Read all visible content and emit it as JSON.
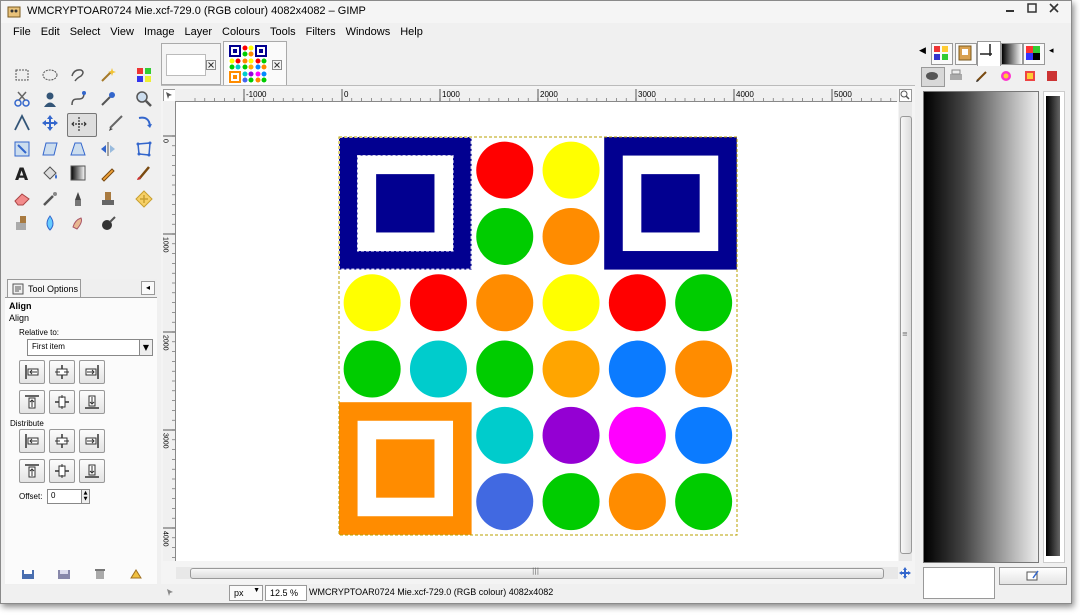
{
  "window": {
    "title": "WMCRYPTOAR0724 Mie.xcf-729.0 (RGB colour) 4082x4082 – GIMP",
    "controls": [
      "minimize",
      "maximize",
      "close"
    ]
  },
  "menu": [
    "File",
    "Edit",
    "Select",
    "View",
    "Image",
    "Layer",
    "Colours",
    "Tools",
    "Filters",
    "Windows",
    "Help"
  ],
  "tool_options": {
    "tab_label": "Tool Options",
    "heading": "Align",
    "subheading": "Align",
    "relative_label": "Relative to:",
    "relative_value": "First item",
    "distribute_label": "Distribute",
    "offset_label": "Offset:",
    "offset_value": "0"
  },
  "ruler_h": {
    "labels": [
      "-1000",
      "0",
      "1000",
      "2000",
      "3000",
      "4000",
      "5000"
    ]
  },
  "ruler_v": {
    "labels": [
      "0",
      "1000",
      "2000",
      "3000",
      "4000"
    ]
  },
  "status": {
    "unit": "px",
    "zoom": "12.5 %",
    "text": "WMCRYPTOAR0724 Mie.xcf-729.0 (RGB colour) 4082x4082"
  },
  "colors": {
    "navy": "#020090",
    "orange": "#ff8c00",
    "red": "#ff0000",
    "yellow": "#ffff00",
    "green": "#00cc00",
    "cyan": "#00cccc",
    "amber": "#ffa500",
    "azure": "#0b7bff",
    "purple": "#9400d3",
    "magenta": "#ff00ff",
    "royal": "#4169e1"
  },
  "artwork": {
    "corners": [
      {
        "color": "navy",
        "position": "top-left",
        "selected": true
      },
      {
        "color": "navy",
        "position": "top-right",
        "selected": false
      },
      {
        "color": "orange",
        "position": "bottom-left",
        "selected": false
      }
    ],
    "circle_grid": [
      [
        "-",
        "-",
        "red",
        "yellow",
        "-",
        "-"
      ],
      [
        "-",
        "-",
        "green",
        "orange",
        "-",
        "-"
      ],
      [
        "yellow",
        "red",
        "orange",
        "yellow",
        "red",
        "green"
      ],
      [
        "green",
        "cyan",
        "green",
        "amber",
        "azure",
        "orange"
      ],
      [
        "-",
        "-",
        "cyan",
        "purple",
        "magenta",
        "azure"
      ],
      [
        "-",
        "-",
        "royal",
        "green",
        "orange",
        "green"
      ]
    ]
  }
}
